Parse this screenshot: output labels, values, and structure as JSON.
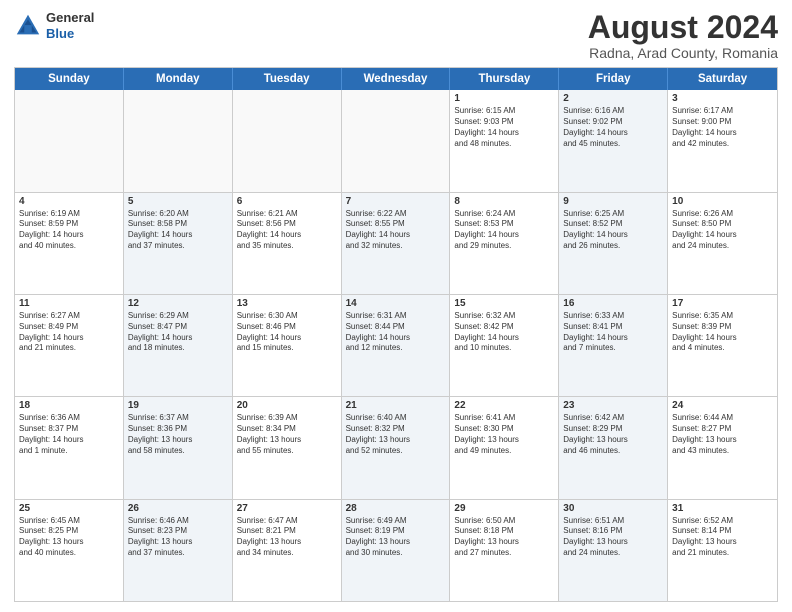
{
  "header": {
    "logo_general": "General",
    "logo_blue": "Blue",
    "title": "August 2024",
    "location": "Radna, Arad County, Romania"
  },
  "days_of_week": [
    "Sunday",
    "Monday",
    "Tuesday",
    "Wednesday",
    "Thursday",
    "Friday",
    "Saturday"
  ],
  "weeks": [
    [
      {
        "day": "",
        "info": "",
        "shaded": false,
        "empty": true
      },
      {
        "day": "",
        "info": "",
        "shaded": false,
        "empty": true
      },
      {
        "day": "",
        "info": "",
        "shaded": false,
        "empty": true
      },
      {
        "day": "",
        "info": "",
        "shaded": false,
        "empty": true
      },
      {
        "day": "1",
        "info": "Sunrise: 6:15 AM\nSunset: 9:03 PM\nDaylight: 14 hours\nand 48 minutes.",
        "shaded": false
      },
      {
        "day": "2",
        "info": "Sunrise: 6:16 AM\nSunset: 9:02 PM\nDaylight: 14 hours\nand 45 minutes.",
        "shaded": true
      },
      {
        "day": "3",
        "info": "Sunrise: 6:17 AM\nSunset: 9:00 PM\nDaylight: 14 hours\nand 42 minutes.",
        "shaded": false
      }
    ],
    [
      {
        "day": "4",
        "info": "Sunrise: 6:19 AM\nSunset: 8:59 PM\nDaylight: 14 hours\nand 40 minutes.",
        "shaded": false
      },
      {
        "day": "5",
        "info": "Sunrise: 6:20 AM\nSunset: 8:58 PM\nDaylight: 14 hours\nand 37 minutes.",
        "shaded": true
      },
      {
        "day": "6",
        "info": "Sunrise: 6:21 AM\nSunset: 8:56 PM\nDaylight: 14 hours\nand 35 minutes.",
        "shaded": false
      },
      {
        "day": "7",
        "info": "Sunrise: 6:22 AM\nSunset: 8:55 PM\nDaylight: 14 hours\nand 32 minutes.",
        "shaded": true
      },
      {
        "day": "8",
        "info": "Sunrise: 6:24 AM\nSunset: 8:53 PM\nDaylight: 14 hours\nand 29 minutes.",
        "shaded": false
      },
      {
        "day": "9",
        "info": "Sunrise: 6:25 AM\nSunset: 8:52 PM\nDaylight: 14 hours\nand 26 minutes.",
        "shaded": true
      },
      {
        "day": "10",
        "info": "Sunrise: 6:26 AM\nSunset: 8:50 PM\nDaylight: 14 hours\nand 24 minutes.",
        "shaded": false
      }
    ],
    [
      {
        "day": "11",
        "info": "Sunrise: 6:27 AM\nSunset: 8:49 PM\nDaylight: 14 hours\nand 21 minutes.",
        "shaded": false
      },
      {
        "day": "12",
        "info": "Sunrise: 6:29 AM\nSunset: 8:47 PM\nDaylight: 14 hours\nand 18 minutes.",
        "shaded": true
      },
      {
        "day": "13",
        "info": "Sunrise: 6:30 AM\nSunset: 8:46 PM\nDaylight: 14 hours\nand 15 minutes.",
        "shaded": false
      },
      {
        "day": "14",
        "info": "Sunrise: 6:31 AM\nSunset: 8:44 PM\nDaylight: 14 hours\nand 12 minutes.",
        "shaded": true
      },
      {
        "day": "15",
        "info": "Sunrise: 6:32 AM\nSunset: 8:42 PM\nDaylight: 14 hours\nand 10 minutes.",
        "shaded": false
      },
      {
        "day": "16",
        "info": "Sunrise: 6:33 AM\nSunset: 8:41 PM\nDaylight: 14 hours\nand 7 minutes.",
        "shaded": true
      },
      {
        "day": "17",
        "info": "Sunrise: 6:35 AM\nSunset: 8:39 PM\nDaylight: 14 hours\nand 4 minutes.",
        "shaded": false
      }
    ],
    [
      {
        "day": "18",
        "info": "Sunrise: 6:36 AM\nSunset: 8:37 PM\nDaylight: 14 hours\nand 1 minute.",
        "shaded": false
      },
      {
        "day": "19",
        "info": "Sunrise: 6:37 AM\nSunset: 8:36 PM\nDaylight: 13 hours\nand 58 minutes.",
        "shaded": true
      },
      {
        "day": "20",
        "info": "Sunrise: 6:39 AM\nSunset: 8:34 PM\nDaylight: 13 hours\nand 55 minutes.",
        "shaded": false
      },
      {
        "day": "21",
        "info": "Sunrise: 6:40 AM\nSunset: 8:32 PM\nDaylight: 13 hours\nand 52 minutes.",
        "shaded": true
      },
      {
        "day": "22",
        "info": "Sunrise: 6:41 AM\nSunset: 8:30 PM\nDaylight: 13 hours\nand 49 minutes.",
        "shaded": false
      },
      {
        "day": "23",
        "info": "Sunrise: 6:42 AM\nSunset: 8:29 PM\nDaylight: 13 hours\nand 46 minutes.",
        "shaded": true
      },
      {
        "day": "24",
        "info": "Sunrise: 6:44 AM\nSunset: 8:27 PM\nDaylight: 13 hours\nand 43 minutes.",
        "shaded": false
      }
    ],
    [
      {
        "day": "25",
        "info": "Sunrise: 6:45 AM\nSunset: 8:25 PM\nDaylight: 13 hours\nand 40 minutes.",
        "shaded": false
      },
      {
        "day": "26",
        "info": "Sunrise: 6:46 AM\nSunset: 8:23 PM\nDaylight: 13 hours\nand 37 minutes.",
        "shaded": true
      },
      {
        "day": "27",
        "info": "Sunrise: 6:47 AM\nSunset: 8:21 PM\nDaylight: 13 hours\nand 34 minutes.",
        "shaded": false
      },
      {
        "day": "28",
        "info": "Sunrise: 6:49 AM\nSunset: 8:19 PM\nDaylight: 13 hours\nand 30 minutes.",
        "shaded": true
      },
      {
        "day": "29",
        "info": "Sunrise: 6:50 AM\nSunset: 8:18 PM\nDaylight: 13 hours\nand 27 minutes.",
        "shaded": false
      },
      {
        "day": "30",
        "info": "Sunrise: 6:51 AM\nSunset: 8:16 PM\nDaylight: 13 hours\nand 24 minutes.",
        "shaded": true
      },
      {
        "day": "31",
        "info": "Sunrise: 6:52 AM\nSunset: 8:14 PM\nDaylight: 13 hours\nand 21 minutes.",
        "shaded": false
      }
    ]
  ]
}
